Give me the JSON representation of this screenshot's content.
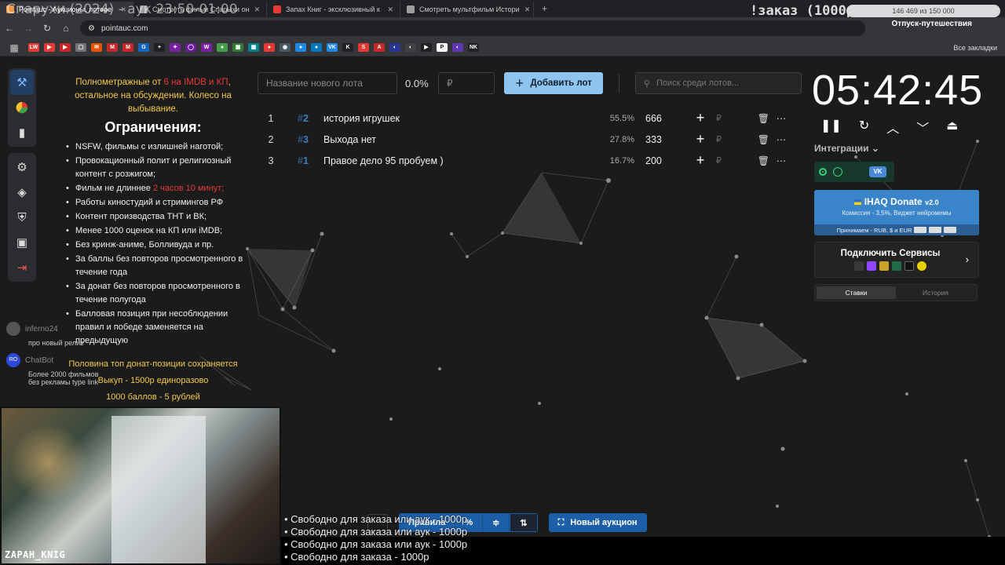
{
  "tabs": [
    {
      "title": "Pointauc - Аукционы, лотере",
      "color": "#f2994a"
    },
    {
      "title": "Смотреть фильм Спарыхи он",
      "color": "#9e9e9e"
    },
    {
      "title": "Запах Книг - эксклюзивный к",
      "color": "#e53935"
    },
    {
      "title": "Смотреть мультфильм Истори",
      "color": "#9e9e9e"
    }
  ],
  "overlay": {
    "title": "Спарухи (2024) - аук 23:50-01:00",
    "order": "!заказ (1000р)",
    "donate_progress": "146 469 из 150 000",
    "donate_fraction": 0.976,
    "vacation": "Отпуск-путешествия"
  },
  "url": "pointauc.com",
  "bookmarks_all": "Все закладки",
  "bookmark_icons": [
    {
      "label": "LW",
      "color": "#e53935"
    },
    {
      "label": "▶",
      "color": "#e53935"
    },
    {
      "label": "▶",
      "color": "#c62828"
    },
    {
      "label": "▢",
      "color": "#757575"
    },
    {
      "label": "✉",
      "color": "#e65100"
    },
    {
      "label": "M",
      "color": "#c62828"
    },
    {
      "label": "M",
      "color": "#c62828"
    },
    {
      "label": "G",
      "color": "#1565c0"
    },
    {
      "label": "+",
      "color": "#212121"
    },
    {
      "label": "✦",
      "color": "#7b1fa2"
    },
    {
      "label": "◯",
      "color": "#6a1b9a"
    },
    {
      "label": "W",
      "color": "#7b1fa2"
    },
    {
      "label": "●",
      "color": "#43a047"
    },
    {
      "label": "▦",
      "color": "#2e7d32"
    },
    {
      "label": "▦",
      "color": "#00838f"
    },
    {
      "label": "●",
      "color": "#e53935"
    },
    {
      "label": "◉",
      "color": "#455a64"
    },
    {
      "label": "●",
      "color": "#1e88e5"
    },
    {
      "label": "●",
      "color": "#0277bd"
    },
    {
      "label": "VK",
      "color": "#1e88e5"
    },
    {
      "label": "K",
      "color": "#212121"
    },
    {
      "label": "S",
      "color": "#e53935"
    },
    {
      "label": "A",
      "color": "#c62828"
    },
    {
      "label": "◐",
      "color": "#283593"
    },
    {
      "label": "◐",
      "color": "#424242"
    },
    {
      "label": "▶",
      "color": "#212121"
    },
    {
      "label": "P",
      "color": "#fafafa"
    },
    {
      "label": "◐",
      "color": "#5e35b1"
    },
    {
      "label": "NK",
      "color": "#212121"
    }
  ],
  "rules": {
    "intro_a": "Полнометражные от ",
    "intro_red": "6 на IMDB и КП",
    "intro_b": ", остальное на обсуждении. Колесо на выбывание.",
    "heading": "Ограничения:",
    "items": [
      "NSFW, фильмы с излишней наготой;",
      "Провокационный полит и религиозный контент с розжигом;",
      "Фильм не длиннее ",
      "Работы киностудий и стримингов РФ",
      "Контент производства ТНТ и ВК;",
      "Менее 1000 оценок на КП или iMDB;",
      "Без кринж-аниме, Болливуда и пр.",
      "За баллы без повторов просмотренного в течение года",
      "За донат без повторов просмотренного в течение полугода",
      "Балловая позиция при несоблюдении правил и победе заменяется на предыдущую"
    ],
    "length_limit": "2 часов 10 минут;",
    "half_top": "Половина топ донат-позиции сохраняется",
    "buyout": "Выкуп - 1500р единоразово",
    "points_rate": "1000 баллов - 5 рублей"
  },
  "chat": [
    {
      "name": "inferno24",
      "msg": "про новый релиз"
    },
    {
      "name": "ChatBot",
      "msg": "Более 2000 фильмов без рекламы type link"
    }
  ],
  "webcam_nick": "ZAPAH_KNIG",
  "toolbar": {
    "lot_placeholder": "Название нового лота",
    "percent": "0.0%",
    "amount_placeholder": "₽",
    "add_label": "Добавить лот",
    "search_placeholder": "Поиск среди лотов..."
  },
  "lots": [
    {
      "pos": "1",
      "id": "2",
      "name": "история игрушек",
      "percent": "55.5%",
      "amount": "666"
    },
    {
      "pos": "2",
      "id": "3",
      "name": "Выхода нет",
      "percent": "27.8%",
      "amount": "333"
    },
    {
      "pos": "3",
      "id": "1",
      "name": "Правое дело 95 пробуем )",
      "percent": "16.7%",
      "amount": "200"
    }
  ],
  "timer": "05:42:45",
  "integrations": {
    "label": "Интеграции",
    "vk": "VK"
  },
  "ihaq": {
    "title": "IHAQ Donate",
    "version": "v2.0",
    "commission": "Комиссия - 3,5%, Виджет нейромемы",
    "accepts": "Принимаем - RUB, $ и EUR"
  },
  "services": {
    "title": "Подключить Сервисы"
  },
  "bets_tabs": [
    "Ставки",
    "История"
  ],
  "bottom": {
    "rules_label": "Правила",
    "new_auction": "Новый аукцион"
  },
  "queue": [
    "• Свободно для заказа или аук - 1000р",
    "• Свободно для заказа или аук - 1000р",
    "• Свободно для заказа или аук - 1000р",
    "• Свободно для заказа - 1000р"
  ]
}
